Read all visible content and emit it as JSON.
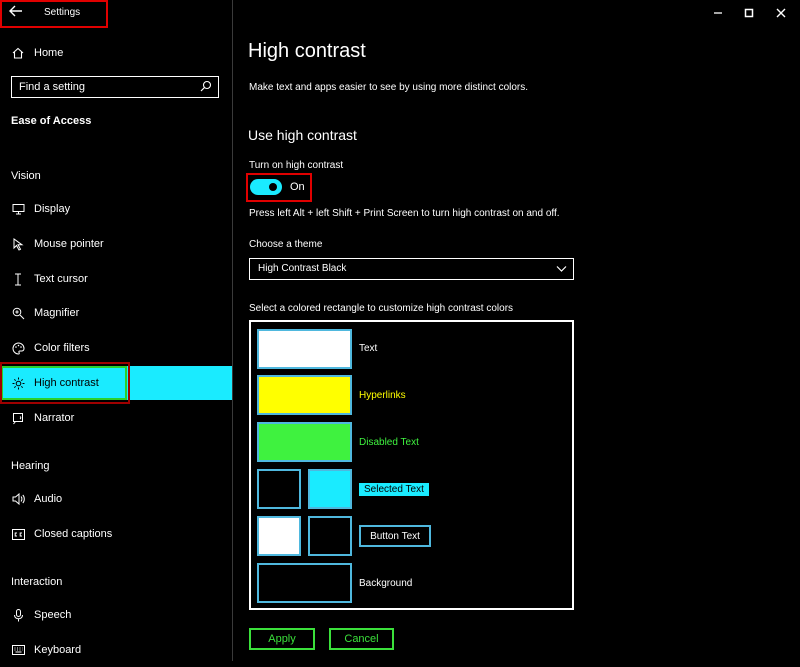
{
  "window": {
    "title": "Settings"
  },
  "sidebar": {
    "home_label": "Home",
    "search_placeholder": "Find a setting",
    "category_title": "Ease of Access",
    "sections": {
      "vision": "Vision",
      "hearing": "Hearing",
      "interaction": "Interaction"
    },
    "items": [
      {
        "label": "Display",
        "icon": "monitor-icon"
      },
      {
        "label": "Mouse pointer",
        "icon": "mouse-pointer-icon"
      },
      {
        "label": "Text cursor",
        "icon": "text-cursor-icon"
      },
      {
        "label": "Magnifier",
        "icon": "magnifier-icon"
      },
      {
        "label": "Color filters",
        "icon": "palette-icon"
      },
      {
        "label": "High contrast",
        "icon": "sun-icon",
        "selected": true
      },
      {
        "label": "Narrator",
        "icon": "narrator-icon"
      },
      {
        "label": "Audio",
        "icon": "speaker-icon"
      },
      {
        "label": "Closed captions",
        "icon": "cc-icon"
      },
      {
        "label": "Speech",
        "icon": "microphone-icon"
      },
      {
        "label": "Keyboard",
        "icon": "keyboard-icon"
      }
    ]
  },
  "main": {
    "page_title": "High contrast",
    "description": "Make text and apps easier to see by using more distinct colors.",
    "section_title": "Use high contrast",
    "toggle_label": "Turn on high contrast",
    "toggle_state": "On",
    "shortcut_hint": "Press left Alt + left Shift + Print Screen to turn high contrast on and off.",
    "theme_label": "Choose a theme",
    "theme_value": "High Contrast Black",
    "colors_label": "Select a colored rectangle to customize high contrast colors",
    "colors": {
      "text": {
        "label": "Text",
        "color": "#ffffff"
      },
      "hyperlinks": {
        "label": "Hyperlinks",
        "color": "#ffff00"
      },
      "disabled_text": {
        "label": "Disabled Text",
        "color": "#3ff23f"
      },
      "selected_text": {
        "label": "Selected Text",
        "fg": "#000000",
        "bg": "#1aebff"
      },
      "button_text": {
        "label": "Button Text",
        "fg": "#ffffff",
        "bg": "#000000"
      },
      "background": {
        "label": "Background",
        "color": "#000000"
      }
    },
    "apply_label": "Apply",
    "cancel_label": "Cancel"
  },
  "accent_colors": {
    "selection": "#1aebff",
    "highlight_box": "#e00000",
    "swatch_border": "#4fb8de",
    "button_green": "#3be03b"
  }
}
